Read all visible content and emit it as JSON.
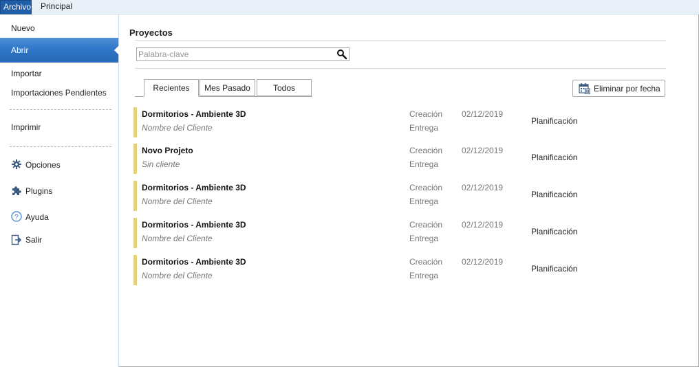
{
  "menubar": {
    "tabs": [
      {
        "label": "Archivo",
        "active": true
      },
      {
        "label": "Principal",
        "active": false
      }
    ]
  },
  "sidebar": {
    "items": [
      {
        "label": "Nuevo"
      },
      {
        "label": "Abrir",
        "active": true
      },
      {
        "label": "Importar"
      },
      {
        "label": "Importaciones Pendientes"
      },
      {
        "label": "Imprimir"
      },
      {
        "label": "Opciones",
        "icon": "gear-icon"
      },
      {
        "label": "Plugins",
        "icon": "puzzle-icon"
      },
      {
        "label": "Ayuda",
        "icon": "help-icon"
      },
      {
        "label": "Salir",
        "icon": "exit-icon"
      }
    ]
  },
  "main": {
    "title": "Proyectos",
    "search": {
      "placeholder": "Palabra-clave",
      "value": "",
      "icon": "search-icon"
    },
    "tabs": [
      {
        "label": "Recientes",
        "active": true
      },
      {
        "label": "Mes Pasado",
        "active": false
      },
      {
        "label": "Todos",
        "active": false
      }
    ],
    "delete_by_date": {
      "label": "Eliminar por fecha",
      "icon": "calendar-delete-icon"
    },
    "accent_color": "#e6d27a",
    "projects": [
      {
        "name": "Dormitorios - Ambiente 3D",
        "client": "Nombre del Cliente",
        "created_label": "Creación",
        "delivery_label": "Entrega",
        "date": "02/12/2019",
        "status": "Planificación"
      },
      {
        "name": "Novo Projeto",
        "client": "Sin cliente",
        "created_label": "Creación",
        "delivery_label": "Entrega",
        "date": "02/12/2019",
        "status": "Planificación"
      },
      {
        "name": "Dormitorios - Ambiente 3D",
        "client": "Nombre del Cliente",
        "created_label": "Creación",
        "delivery_label": "Entrega",
        "date": "02/12/2019",
        "status": "Planificación"
      },
      {
        "name": "Dormitorios - Ambiente 3D",
        "client": "Nombre del Cliente",
        "created_label": "Creación",
        "delivery_label": "Entrega",
        "date": "02/12/2019",
        "status": "Planificación"
      },
      {
        "name": "Dormitorios - Ambiente 3D",
        "client": "Nombre del Cliente",
        "created_label": "Creación",
        "delivery_label": "Entrega",
        "date": "02/12/2019",
        "status": "Planificación"
      }
    ]
  }
}
